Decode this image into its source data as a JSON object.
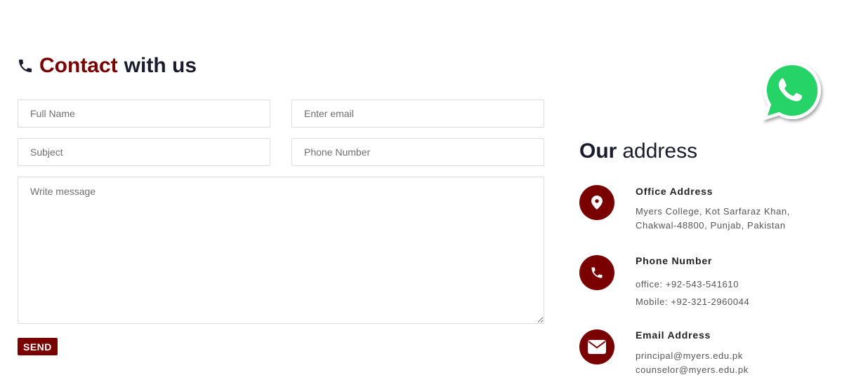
{
  "contact": {
    "title_accent": "Contact",
    "title_rest": "with us",
    "icon": "phone-icon"
  },
  "form": {
    "full_name_placeholder": "Full Name",
    "email_placeholder": "Enter email",
    "subject_placeholder": "Subject",
    "phone_placeholder": "Phone Number",
    "message_placeholder": "Write message",
    "send_label": "SEND"
  },
  "address": {
    "title_strong": "Our",
    "title_rest": "address",
    "office": {
      "icon": "map-pin-icon",
      "heading": "Office Address",
      "lines": [
        "Myers College, Kot Sarfaraz Khan,",
        "Chakwal-48800, Punjab, Pakistan"
      ]
    },
    "phone": {
      "icon": "phone-icon",
      "heading": "Phone Number",
      "lines": [
        "office: +92-543-541610",
        "Mobile: +92-321-2960044"
      ]
    },
    "email": {
      "icon": "envelope-icon",
      "heading": "Email Address",
      "lines": [
        "principal@myers.edu.pk",
        "counselor@myers.edu.pk"
      ]
    }
  },
  "whatsapp": {
    "icon": "whatsapp-icon"
  },
  "colors": {
    "accent": "#7a0000",
    "heading": "#1b1b2f",
    "whatsapp_green": "#25d366"
  }
}
